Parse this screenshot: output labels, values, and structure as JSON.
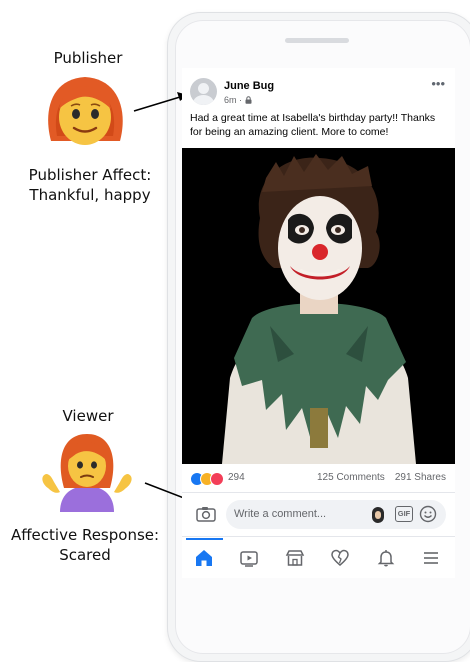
{
  "annotations": {
    "publisher_title": "Publisher",
    "publisher_affect_line1": "Publisher Affect:",
    "publisher_affect_line2": "Thankful, happy",
    "viewer_title": "Viewer",
    "viewer_response_line1": "Affective Response:",
    "viewer_response_line2": "Scared"
  },
  "post": {
    "author": "June Bug",
    "time": "6m",
    "menu_icon": "more-dots-icon",
    "text": "Had a great time at Isabella's birthday party!! Thanks for being an amazing client. More to come!"
  },
  "stats": {
    "reaction_count": "294",
    "comments": "125 Comments",
    "shares": "291 Shares",
    "reaction_icons": [
      "like-icon",
      "haha-icon",
      "love-icon"
    ]
  },
  "comment_bar": {
    "placeholder": "Write a comment...",
    "gif_label": "GIF"
  },
  "tabs": [
    {
      "name": "home",
      "icon": "home-icon",
      "active": true
    },
    {
      "name": "watch",
      "icon": "play-icon",
      "active": false
    },
    {
      "name": "marketplace",
      "icon": "shop-icon",
      "active": false
    },
    {
      "name": "dating",
      "icon": "heart-icon",
      "active": false
    },
    {
      "name": "notifications",
      "icon": "bell-icon",
      "active": false
    },
    {
      "name": "menu",
      "icon": "hamburger-icon",
      "active": false
    }
  ],
  "colors": {
    "accent": "#1877f2",
    "like": "#1877f2",
    "haha": "#f7b125",
    "love": "#f33e58"
  }
}
